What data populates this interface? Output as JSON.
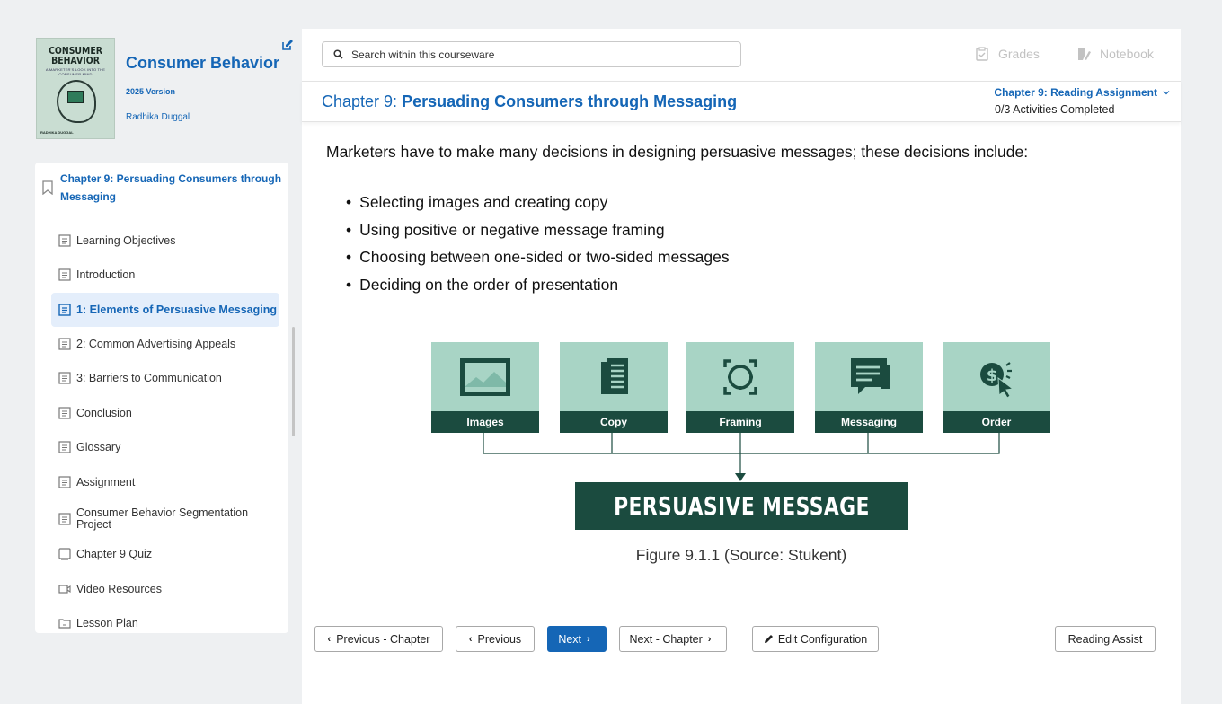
{
  "book": {
    "cover_title": "CONSUMER BEHAVIOR",
    "cover_subtitle": "A MARKETER'S LOOK INTO THE CONSUMER MIND",
    "cover_author": "RADHIKA DUGGAL",
    "title": "Consumer Behavior",
    "version": "2025 Version",
    "author": "Radhika Duggal"
  },
  "toc": {
    "chapter": "Chapter 9: Persuading Consumers through Messaging",
    "items": [
      {
        "label": "Learning Objectives",
        "icon": "page-icon"
      },
      {
        "label": "Introduction",
        "icon": "page-icon"
      },
      {
        "label": "1: Elements of Persuasive Messaging",
        "icon": "page-icon",
        "active": true
      },
      {
        "label": "2: Common Advertising Appeals",
        "icon": "page-icon"
      },
      {
        "label": "3: Barriers to Communication",
        "icon": "page-icon"
      },
      {
        "label": "Conclusion",
        "icon": "page-icon"
      },
      {
        "label": "Glossary",
        "icon": "page-icon"
      },
      {
        "label": "Assignment",
        "icon": "page-icon"
      },
      {
        "label": "Consumer Behavior Segmentation Project",
        "icon": "page-icon"
      },
      {
        "label": "Chapter 9 Quiz",
        "icon": "quiz-icon"
      },
      {
        "label": "Video Resources",
        "icon": "video-icon"
      },
      {
        "label": "Lesson Plan",
        "icon": "lesson-plan-icon"
      }
    ]
  },
  "header": {
    "search_placeholder": "Search within this courseware",
    "grades": "Grades",
    "notebook": "Notebook",
    "chapter_prefix": "Chapter 9:",
    "chapter_title": "Persuading Consumers through Messaging",
    "assignment": "Chapter 9: Reading Assignment",
    "progress": "0/3 Activities Completed"
  },
  "content": {
    "lead": "Marketers have to make many decisions in designing persuasive messages; these decisions include:",
    "bullets": [
      "Selecting images and creating copy",
      "Using positive or negative message framing",
      "Choosing between one-sided or two-sided messages",
      "Deciding on the order of presentation"
    ],
    "figure": {
      "boxes": [
        "Images",
        "Copy",
        "Framing",
        "Messaging",
        "Order"
      ],
      "result": "PERSUASIVE MESSAGE",
      "caption": "Figure 9.1.1 (Source: Stukent)",
      "colors": {
        "box": "#a8d4c5",
        "dark": "#1b4b3f"
      }
    }
  },
  "footer": {
    "prev_chapter": "Previous - Chapter",
    "previous": "Previous",
    "next": "Next",
    "next_chapter": "Next - Chapter",
    "edit_config": "Edit Configuration",
    "reading_assist": "Reading Assist"
  },
  "colors": {
    "accent": "#1566b6",
    "active_bg": "#e4eefb"
  }
}
